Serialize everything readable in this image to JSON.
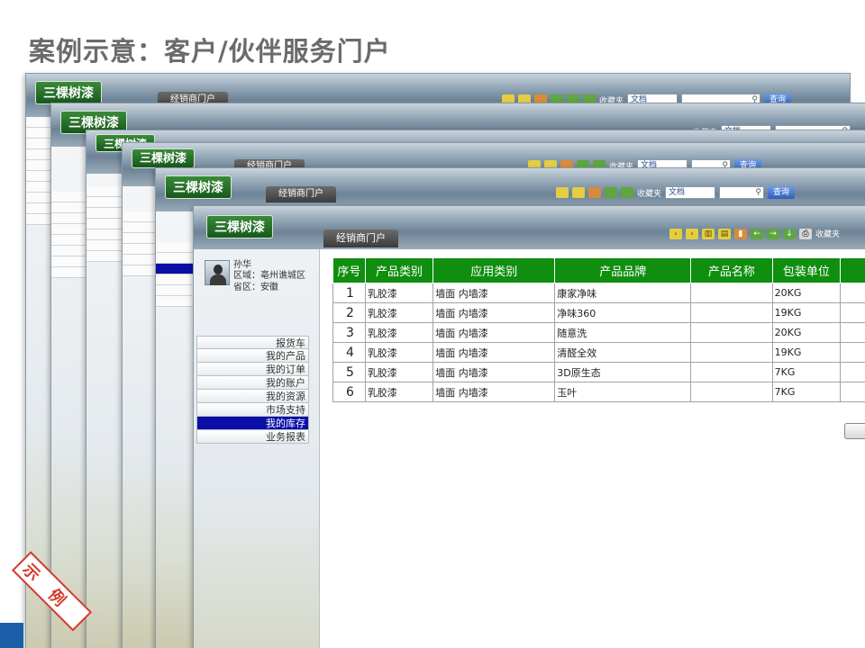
{
  "slide": {
    "title": "案例示意：客户/伙伴服务门户"
  },
  "app": {
    "logo": "三棵树漆",
    "tab": "经销商门户",
    "favorites": "收藏夹",
    "doc_select": "文档",
    "search_button": "查询"
  },
  "profile": {
    "name": "孙华",
    "region": "区域：亳州谯城区",
    "province": "省区：安徽"
  },
  "menu": [
    {
      "label": "报货车"
    },
    {
      "label": "我的产品"
    },
    {
      "label": "我的订单"
    },
    {
      "label": "我的账户"
    },
    {
      "label": "我的资源"
    },
    {
      "label": "市场支持"
    },
    {
      "label": "我的库存",
      "active": true
    },
    {
      "label": "业务报表"
    }
  ],
  "table": {
    "headers": [
      "序号",
      "产品类别",
      "应用类别",
      "产品品牌",
      "产品名称",
      "包装单位"
    ],
    "rows": [
      [
        "1",
        "乳胶漆",
        "墙面 内墙漆",
        "康家净味",
        "",
        "20KG"
      ],
      [
        "2",
        "乳胶漆",
        "墙面 内墙漆",
        "净味360",
        "",
        "19KG"
      ],
      [
        "3",
        "乳胶漆",
        "墙面 内墙漆",
        "随意洗",
        "",
        "20KG"
      ],
      [
        "4",
        "乳胶漆",
        "墙面 内墙漆",
        "清醛全效",
        "",
        "19KG"
      ],
      [
        "5",
        "乳胶漆",
        "墙面 内墙漆",
        "3D原生态",
        "",
        "7KG"
      ],
      [
        "6",
        "乳胶漆",
        "墙面 内墙漆",
        "玉叶",
        "",
        "7KG"
      ]
    ]
  },
  "stamp": {
    "text": "示例"
  },
  "colors": {
    "header_green": "#0f8e0f",
    "active_menu": "#0b0fa8",
    "stamp_red": "#d43a2c",
    "title_gray": "#6b6b6b"
  }
}
